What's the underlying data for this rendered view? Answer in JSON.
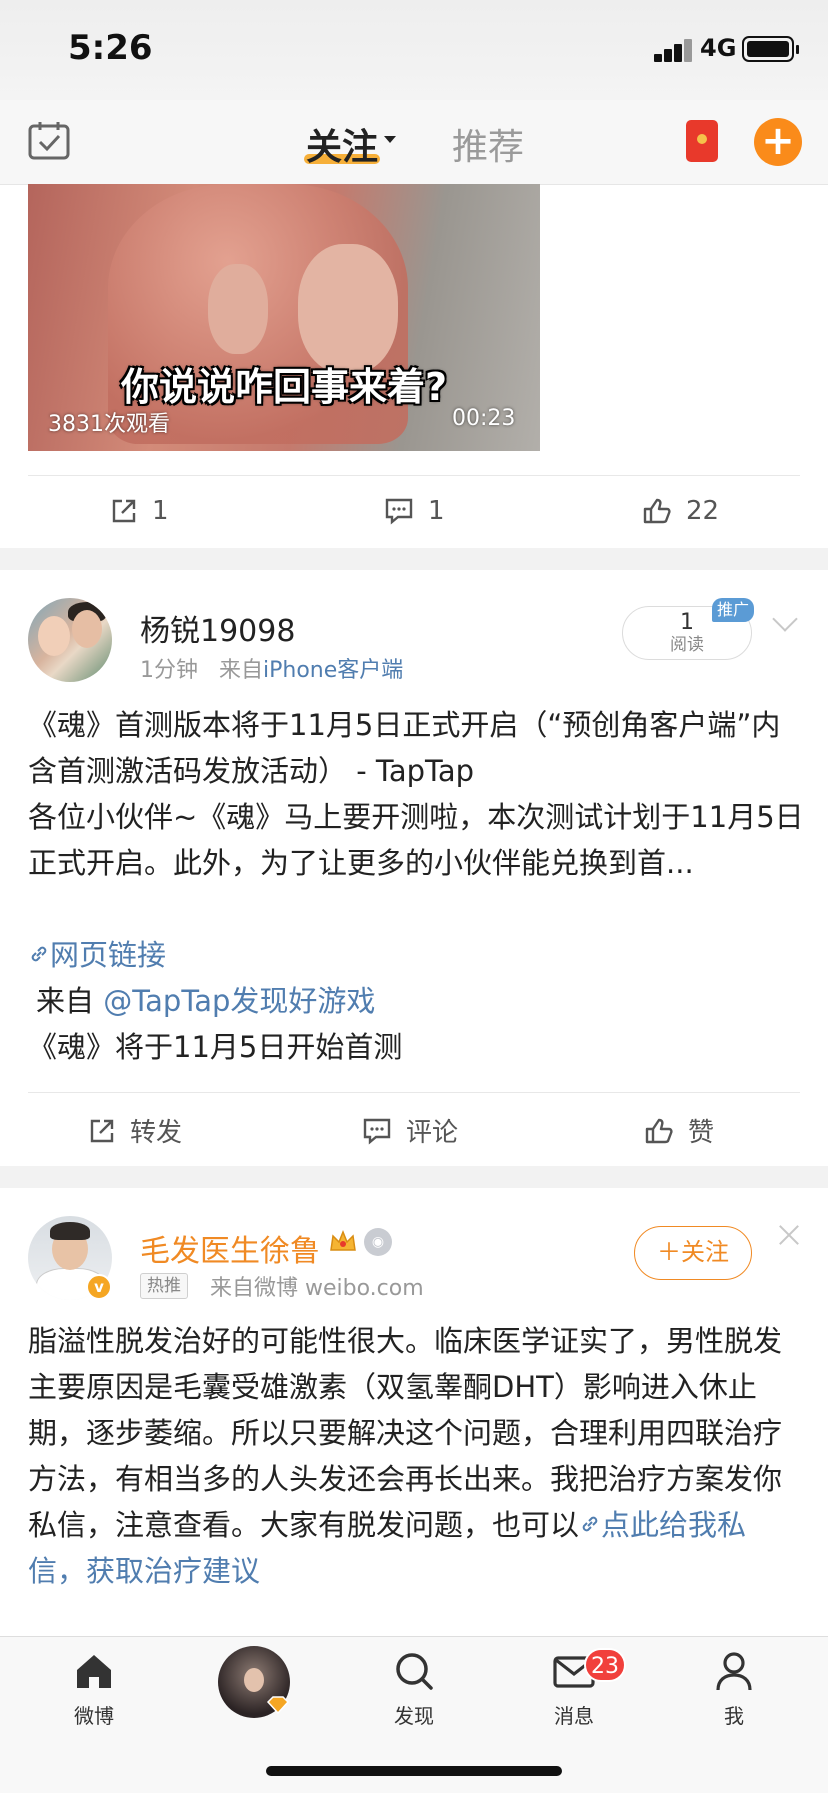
{
  "status_bar": {
    "time": "5:26",
    "network": "4G"
  },
  "top_nav": {
    "tab_follow": "关注",
    "tab_recommend": "推荐"
  },
  "video_card": {
    "caption": "你说说咋回事来着?",
    "views": "3831次观看",
    "duration": "00:23",
    "actions": {
      "repost": "1",
      "comment": "1",
      "like": "22"
    }
  },
  "post1": {
    "username": "杨锐19098",
    "time": "1分钟",
    "source_prefix": "来自",
    "source": "iPhone客户端",
    "read_count": "1",
    "read_label": "阅读",
    "promo_badge": "推广",
    "text": "《魂》首测版本将于11月5日正式开启（“预创角客户端”内含首测激活码发放活动） - TapTap\n各位小伙伴~《魂》马上要开测啦，本次测试计划于11月5日正式开启。此外，为了让更多的小伙伴能兑换到首...",
    "link_text": "网页链接",
    "from_prefix": "来自",
    "from_account": "@TapTap发现好游戏",
    "subline": "《魂》将于11月5日开始首测",
    "actions": {
      "repost": "转发",
      "comment": "评论",
      "like": "赞"
    }
  },
  "post2": {
    "username": "毛发医生徐鲁",
    "hot_badge": "热推",
    "source": "来自微博 weibo.com",
    "follow_label": "＋关注",
    "text": "脂溢性脱发治好的可能性很大。临床医学证实了，男性脱发主要原因是毛囊受雄激素（双氢睾酮DHT）影响进入休止期，逐步萎缩。所以只要解决这个问题，合理利用四联治疗方法，有相当多的人头发还会再长出来。我把治疗方案发你私信，注意查看。大家有脱发问题，也可以",
    "link_text": "点此给我私信，获取治疗建议"
  },
  "tab_bar": {
    "home": "微博",
    "discover": "发现",
    "messages": "消息",
    "messages_badge": "23",
    "me": "我"
  },
  "colors": {
    "accent_orange": "#fa8b1a",
    "link_blue": "#507daf",
    "badge_red": "#f1403c",
    "username_orange": "#f08a24"
  },
  "icons": [
    "checkin-icon",
    "red-packet-icon",
    "plus-icon",
    "share-icon",
    "comment-icon",
    "like-icon",
    "chevron-down-icon",
    "link-icon",
    "crown-icon",
    "medal-icon",
    "close-icon",
    "home-icon",
    "search-icon",
    "mail-icon",
    "person-icon"
  ]
}
